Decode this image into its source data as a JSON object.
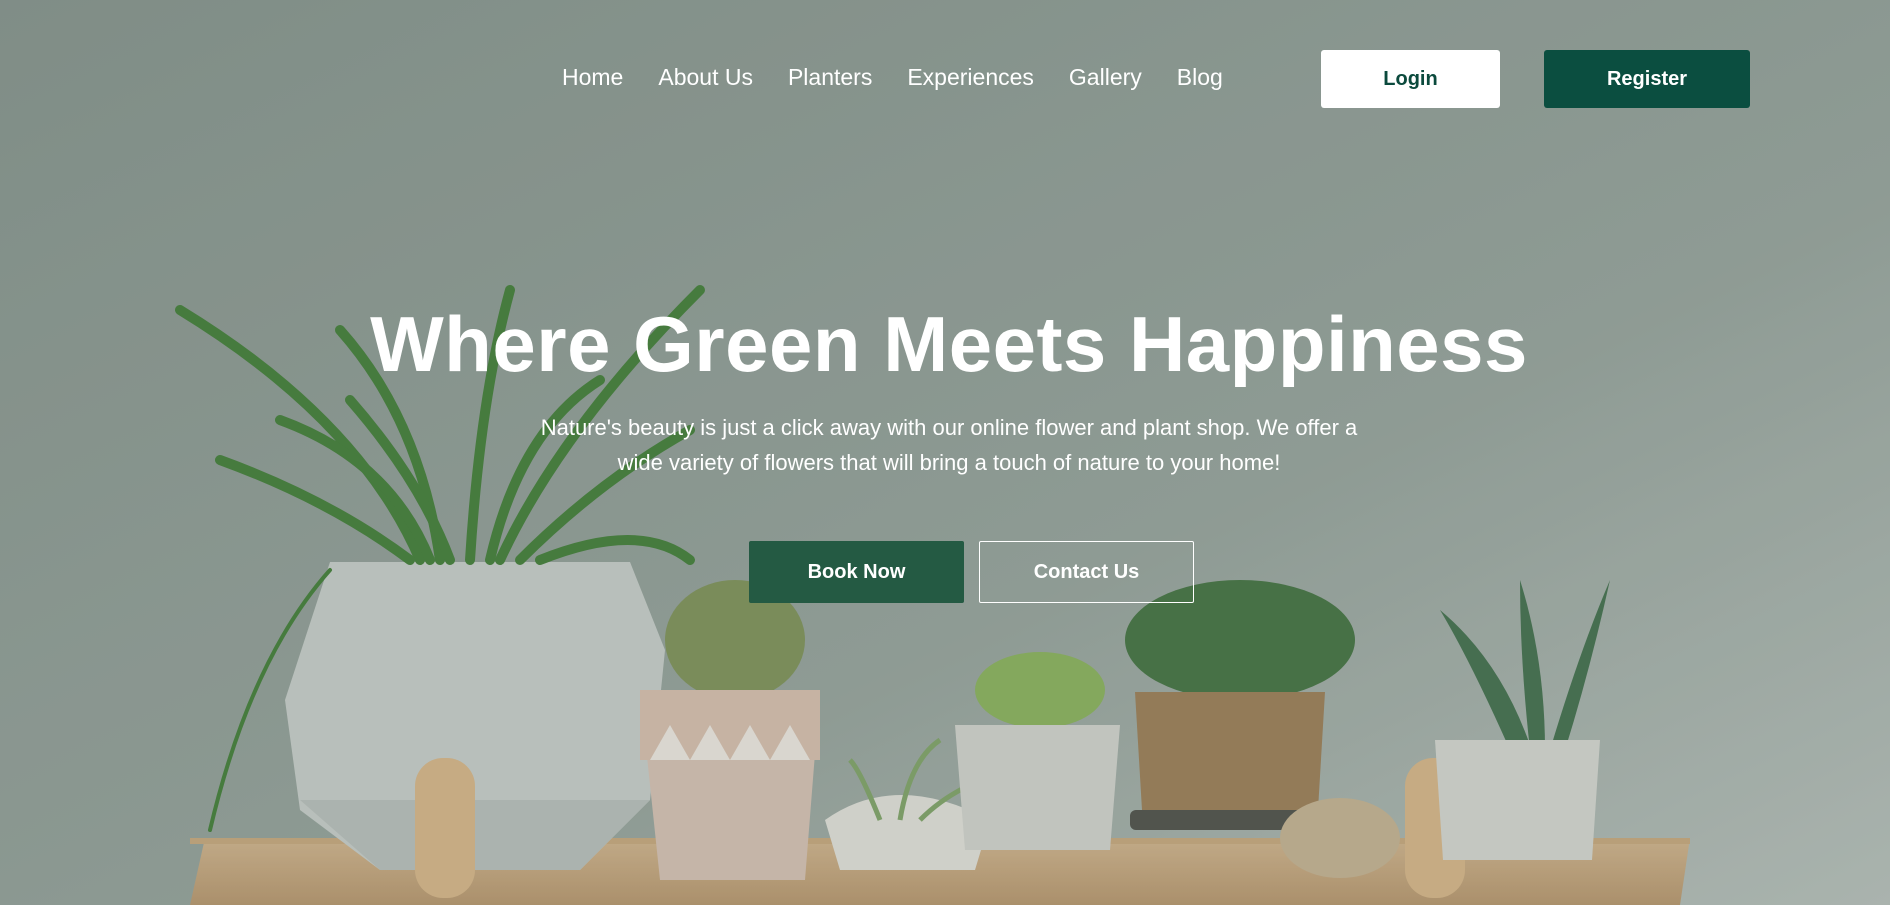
{
  "nav": {
    "items": [
      {
        "label": "Home"
      },
      {
        "label": "About Us"
      },
      {
        "label": "Planters"
      },
      {
        "label": "Experiences"
      },
      {
        "label": "Gallery"
      },
      {
        "label": "Blog"
      }
    ]
  },
  "auth": {
    "login_label": "Login",
    "register_label": "Register"
  },
  "hero": {
    "title": "Where Green Meets Happiness",
    "subtitle_line1": "Nature's beauty is just a click away with our online flower and plant shop. We offer a",
    "subtitle_line2": "wide variety of flowers that will bring a touch of nature to your home!",
    "primary_cta": "Book Now",
    "secondary_cta": "Contact Us"
  },
  "colors": {
    "brand_dark_green": "#0b4e40",
    "book_button_green": "#245a43",
    "text_white": "#ffffff"
  }
}
